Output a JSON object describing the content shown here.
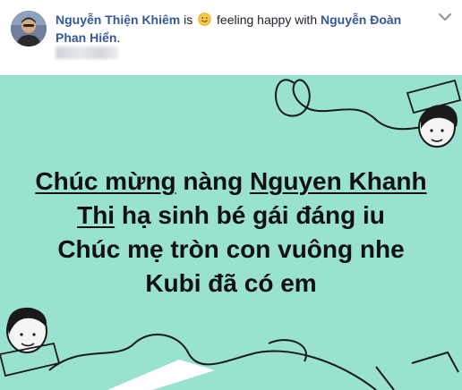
{
  "post": {
    "author": "Nguyễn Thiện Khiêm",
    "is_text": "is",
    "feeling_text": "feeling happy with",
    "tagged_user": "Nguyễn Đoàn Phan Hiển",
    "period": ".",
    "feeling_icon": "smiley-face-icon",
    "menu_icon": "chevron-down-icon"
  },
  "card": {
    "background": "#98e2cf",
    "lines": {
      "l1_a": "Chúc mừng",
      "l1_b": " nàng ",
      "l1_c": "Nguyen Khanh",
      "l2_a": "Thi",
      "l2_b": " hạ sinh bé gái đáng iu",
      "l3": "Chúc mẹ tròn con vuông nhe",
      "l4": "Kubi đã có em"
    }
  },
  "colors": {
    "link": "#365899",
    "text": "#1d2129",
    "message_text": "#111111"
  }
}
